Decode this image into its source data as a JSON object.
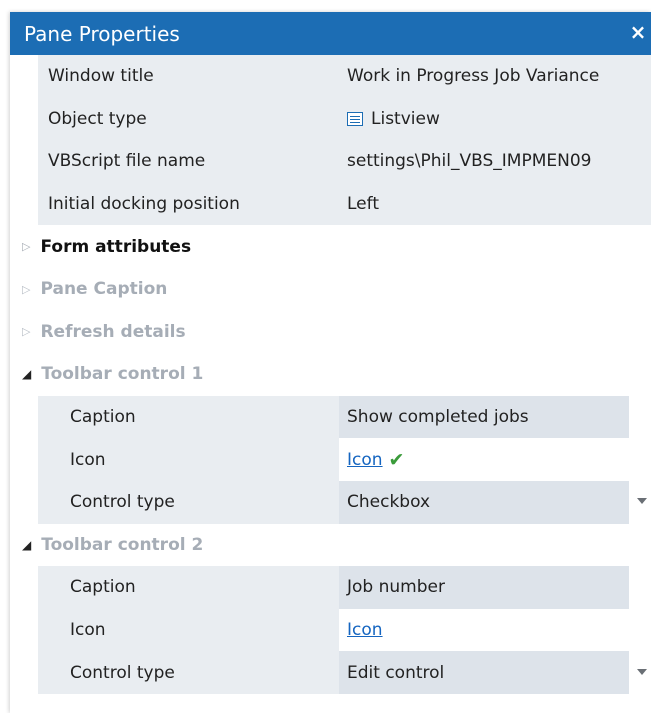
{
  "panel": {
    "title": "Pane Properties",
    "close_label": "×"
  },
  "properties": [
    {
      "label": "Window title",
      "value": "Work in Progress Job Variance"
    },
    {
      "label": "Object type",
      "value": "Listview"
    },
    {
      "label": "VBScript file name",
      "value": "settings\\Phil_VBS_IMPMEN09"
    },
    {
      "label": "Initial docking position",
      "value": "Left"
    }
  ],
  "groups": {
    "form_attributes": "Form attributes",
    "pane_caption": "Pane Caption",
    "refresh_details": "Refresh details",
    "toolbar_control_1": "Toolbar control 1",
    "toolbar_control_2": "Toolbar control 2"
  },
  "toolbar_control_1": {
    "caption_label": "Caption",
    "caption_value": "Show completed jobs",
    "icon_label": "Icon",
    "icon_value": "Icon",
    "icon_status": "checkmark",
    "control_type_label": "Control type",
    "control_type_value": "Checkbox"
  },
  "toolbar_control_2": {
    "caption_label": "Caption",
    "caption_value": "Job number",
    "icon_label": "Icon",
    "icon_value": "Icon",
    "control_type_label": "Control type",
    "control_type_value": "Edit control"
  },
  "colors": {
    "titlebar": "#1c6db4",
    "row_bg": "#e9edf1",
    "link": "#1565c0",
    "check": "#3a9b3a"
  }
}
